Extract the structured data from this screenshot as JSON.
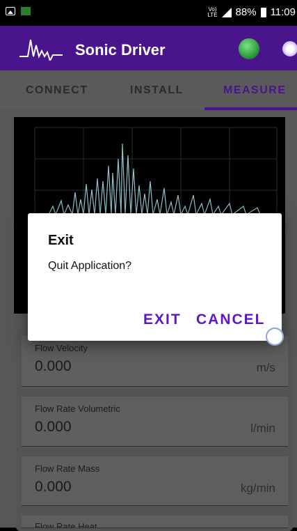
{
  "statusbar": {
    "network_top": "Vo)",
    "network_bottom": "LTE",
    "battery": "88%",
    "time": "11:09"
  },
  "appbar": {
    "title": "Sonic Driver",
    "status_led_color": "#2e9e3c"
  },
  "tabs": [
    {
      "label": "CONNECT"
    },
    {
      "label": "INSTALL"
    },
    {
      "label": "MEASURE"
    }
  ],
  "measurements": [
    {
      "label": "Flow Velocity",
      "value": "0.000",
      "unit": "m/s"
    },
    {
      "label": "Flow Rate Volumetric",
      "value": "0.000",
      "unit": "l/min"
    },
    {
      "label": "Flow Rate Mass",
      "value": "0.000",
      "unit": "kg/min"
    },
    {
      "label": "Flow Rate Heat",
      "value": "",
      "unit": ""
    }
  ],
  "dialog": {
    "title": "Exit",
    "message": "Quit Application?",
    "exit_label": "EXIT",
    "cancel_label": "CANCEL"
  },
  "colors": {
    "primary": "#4a148c",
    "accent": "#5e17c7"
  }
}
